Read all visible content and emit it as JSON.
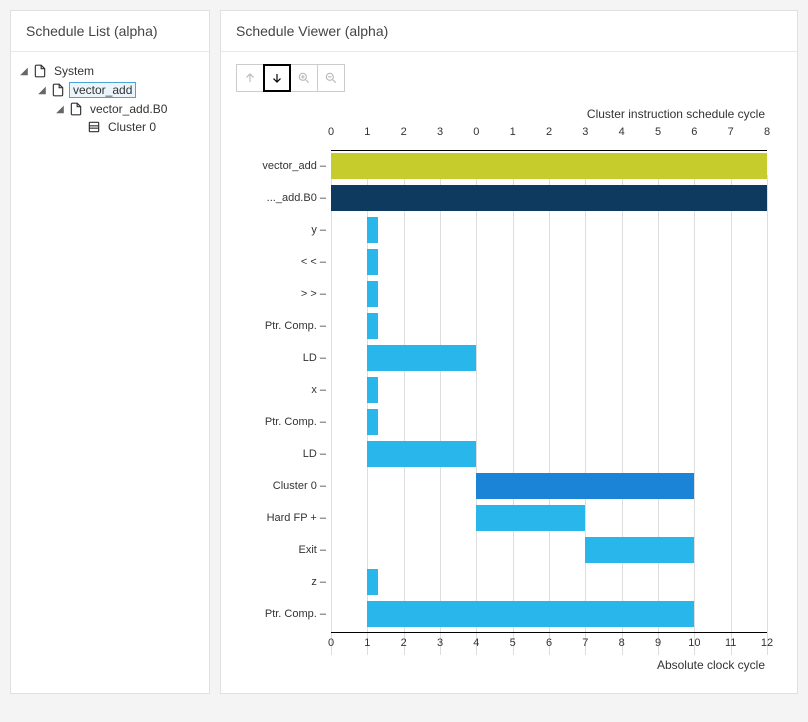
{
  "leftPanel": {
    "title": "Schedule List (alpha)",
    "tree": {
      "system": {
        "label": "System",
        "expanded": true
      },
      "vector_add": {
        "label": "vector_add",
        "expanded": true,
        "selected": true
      },
      "vector_add_b0": {
        "label": "vector_add.B0",
        "expanded": true
      },
      "cluster0": {
        "label": "Cluster 0"
      }
    }
  },
  "rightPanel": {
    "title": "Schedule Viewer (alpha)"
  },
  "chart_data": {
    "type": "bar",
    "top_axis": {
      "title": "Cluster instruction schedule cycle",
      "ticks": [
        0,
        1,
        2,
        3,
        0,
        1,
        2,
        3,
        4,
        5,
        6,
        7,
        8
      ],
      "positions": [
        0,
        1,
        2,
        3,
        4,
        5,
        6,
        7,
        8,
        9,
        10,
        11,
        12
      ],
      "max": 12
    },
    "bottom_axis": {
      "title": "Absolute clock cycle",
      "ticks": [
        0,
        1,
        2,
        3,
        4,
        5,
        6,
        7,
        8,
        9,
        10,
        11,
        12
      ],
      "max": 12
    },
    "rows": [
      {
        "label": "vector_add",
        "start": 0.0,
        "end": 12.0,
        "color": "c-olive"
      },
      {
        "label": "..._add.B0",
        "start": 0.0,
        "end": 12.0,
        "color": "c-navy"
      },
      {
        "label": "y",
        "start": 1.0,
        "end": 1.3,
        "color": "c-cyan"
      },
      {
        "label": "< <",
        "start": 1.0,
        "end": 1.3,
        "color": "c-cyan"
      },
      {
        "label": "> >",
        "start": 1.0,
        "end": 1.3,
        "color": "c-cyan"
      },
      {
        "label": "Ptr. Comp.",
        "start": 1.0,
        "end": 1.3,
        "color": "c-cyan"
      },
      {
        "label": "LD",
        "start": 1.0,
        "end": 4.0,
        "color": "c-cyan"
      },
      {
        "label": "x",
        "start": 1.0,
        "end": 1.3,
        "color": "c-cyan"
      },
      {
        "label": "Ptr. Comp.",
        "start": 1.0,
        "end": 1.3,
        "color": "c-cyan"
      },
      {
        "label": "LD",
        "start": 1.0,
        "end": 4.0,
        "color": "c-cyan"
      },
      {
        "label": "Cluster 0",
        "start": 4.0,
        "end": 10.0,
        "color": "c-blue"
      },
      {
        "label": "Hard FP +",
        "start": 4.0,
        "end": 7.0,
        "color": "c-cyan"
      },
      {
        "label": "Exit",
        "start": 7.0,
        "end": 10.0,
        "color": "c-cyan"
      },
      {
        "label": "z",
        "start": 1.0,
        "end": 1.3,
        "color": "c-cyan"
      },
      {
        "label": "Ptr. Comp.",
        "start": 1.0,
        "end": 10.0,
        "color": "c-cyan"
      }
    ]
  }
}
